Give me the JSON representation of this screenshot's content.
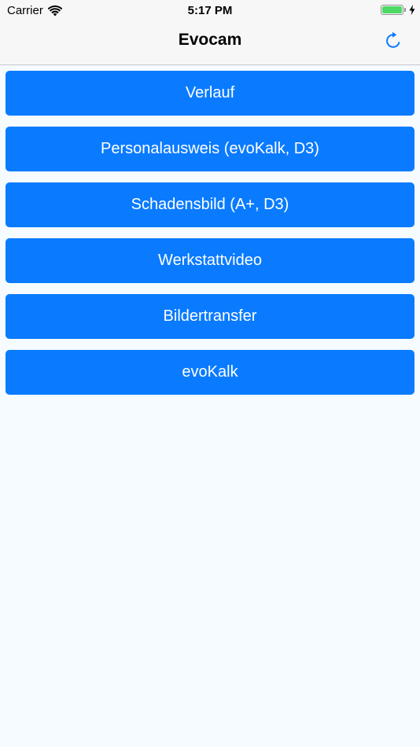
{
  "status_bar": {
    "carrier": "Carrier",
    "time": "5:17 PM",
    "battery_level": 1.0,
    "battery_color": "#4cd964"
  },
  "nav": {
    "title": "Evocam",
    "accent_color": "#0a7bff",
    "refresh_icon": "refresh-icon"
  },
  "menu": {
    "button_color": "#0a7bff",
    "items": [
      {
        "label": "Verlauf"
      },
      {
        "label": "Personalausweis (evoKalk, D3)"
      },
      {
        "label": "Schadensbild (A+, D3)"
      },
      {
        "label": "Werkstattvideo"
      },
      {
        "label": "Bildertransfer"
      },
      {
        "label": "evoKalk"
      }
    ]
  }
}
